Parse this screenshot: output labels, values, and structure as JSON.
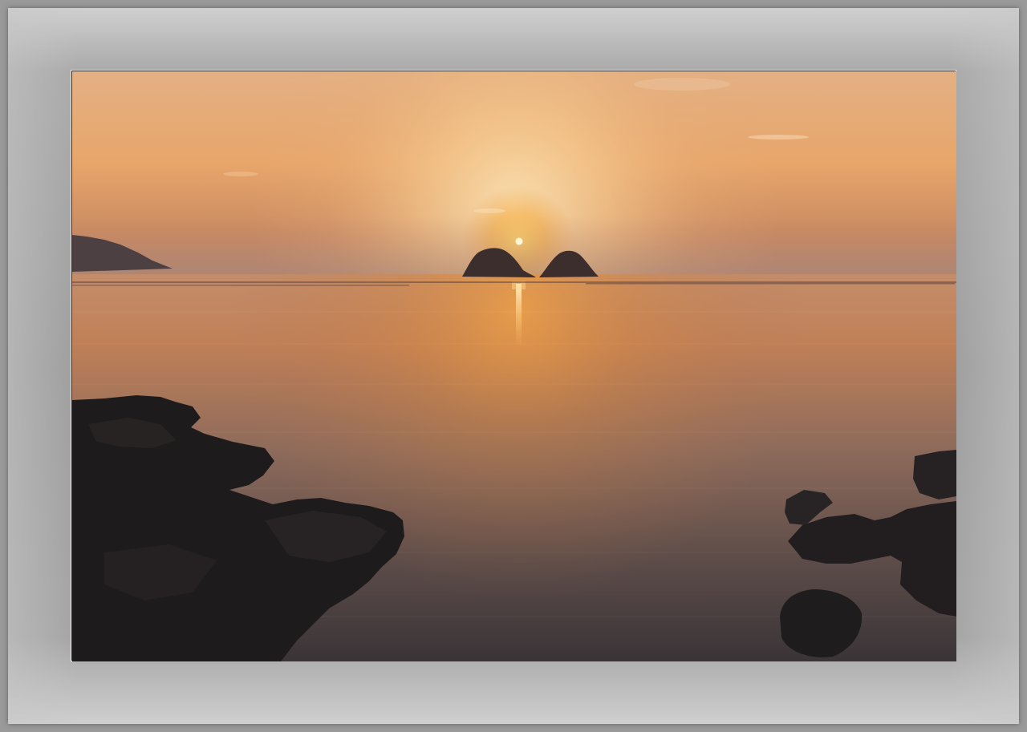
{
  "scene": {
    "subject": "sunset-over-sea",
    "colors": {
      "sky_top": "#e9b98a",
      "sky_glow": "#f6cf9a",
      "sky_horizon": "#d28a55",
      "sun": "#fff6da",
      "water_near_horizon": "#c88b5c",
      "water_mid": "#8a6856",
      "water_deep": "#3d3637",
      "rock": "#1c1a1a",
      "frame_gray": "#9d9d9d",
      "mat_border": "#f2f2f2"
    }
  }
}
